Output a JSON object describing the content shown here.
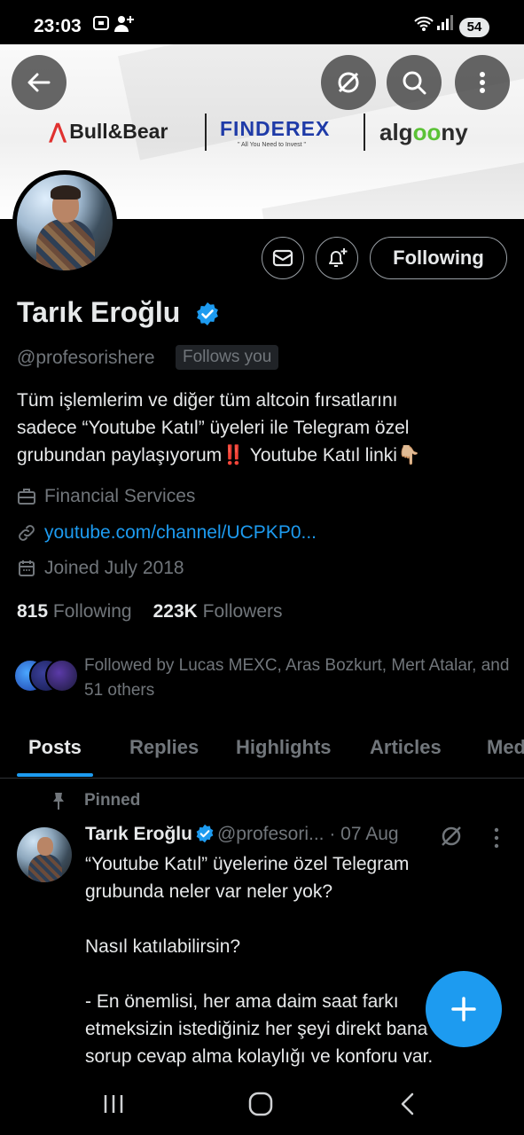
{
  "status_bar": {
    "time": "23:03",
    "battery": "54",
    "icons": [
      "screenshot-icon",
      "person-add-icon",
      "wifi-icon",
      "signal-icon"
    ]
  },
  "banner": {
    "logos": {
      "bull_bear": "Bull&Bear",
      "finderex": "FINDEREX",
      "finderex_tagline": "\" All You Need to Invest \"",
      "algoony_pre": "alg",
      "algoony_oo": "oo",
      "algoony_post": "ny"
    }
  },
  "profile": {
    "name": "Tarık Eroğlu",
    "handle": "@profesorishere",
    "follows_you": "Follows you",
    "bio_lines": [
      "Tüm işlemlerim ve diğer tüm altcoin fırsatlarını",
      "sadece “Youtube Katıl” üyeleri ile Telegram özel",
      "grubundan paylaşıyorum",
      "‼️",
      " Youtube Katıl linki",
      "👇🏼"
    ],
    "category": "Financial Services",
    "link": "youtube.com/channel/UCPKP0...",
    "joined": "Joined July 2018",
    "following_count": "815",
    "following_label": "Following",
    "followers_count": "223K",
    "followers_label": "Followers",
    "followed_by": "Followed by Lucas MEXC, Aras Bozkurt, Mert Atalar, and 51 others"
  },
  "actions": {
    "following_button": "Following"
  },
  "tabs": [
    "Posts",
    "Replies",
    "Highlights",
    "Articles",
    "Media"
  ],
  "active_tab": "Posts",
  "pinned_post": {
    "pinned_label": "Pinned",
    "author": "Tarık Eroğlu",
    "handle": "@profesori...",
    "date": "· 07 Aug",
    "lines": [
      "“Youtube Katıl” üyelerine özel Telegram",
      "grubunda neler var neler yok?",
      "",
      "Nasıl katılabilirsin?",
      "",
      "- En önemlisi, her ama daim saat farkı",
      "etmeksizin istediğiniz her şeyi direkt bana",
      "sorup cevap alma kolaylığı ve konforu var."
    ]
  },
  "colors": {
    "accent": "#1d9bf0",
    "background": "#000000",
    "text_primary": "#e7e9ea",
    "text_secondary": "#71767b"
  }
}
